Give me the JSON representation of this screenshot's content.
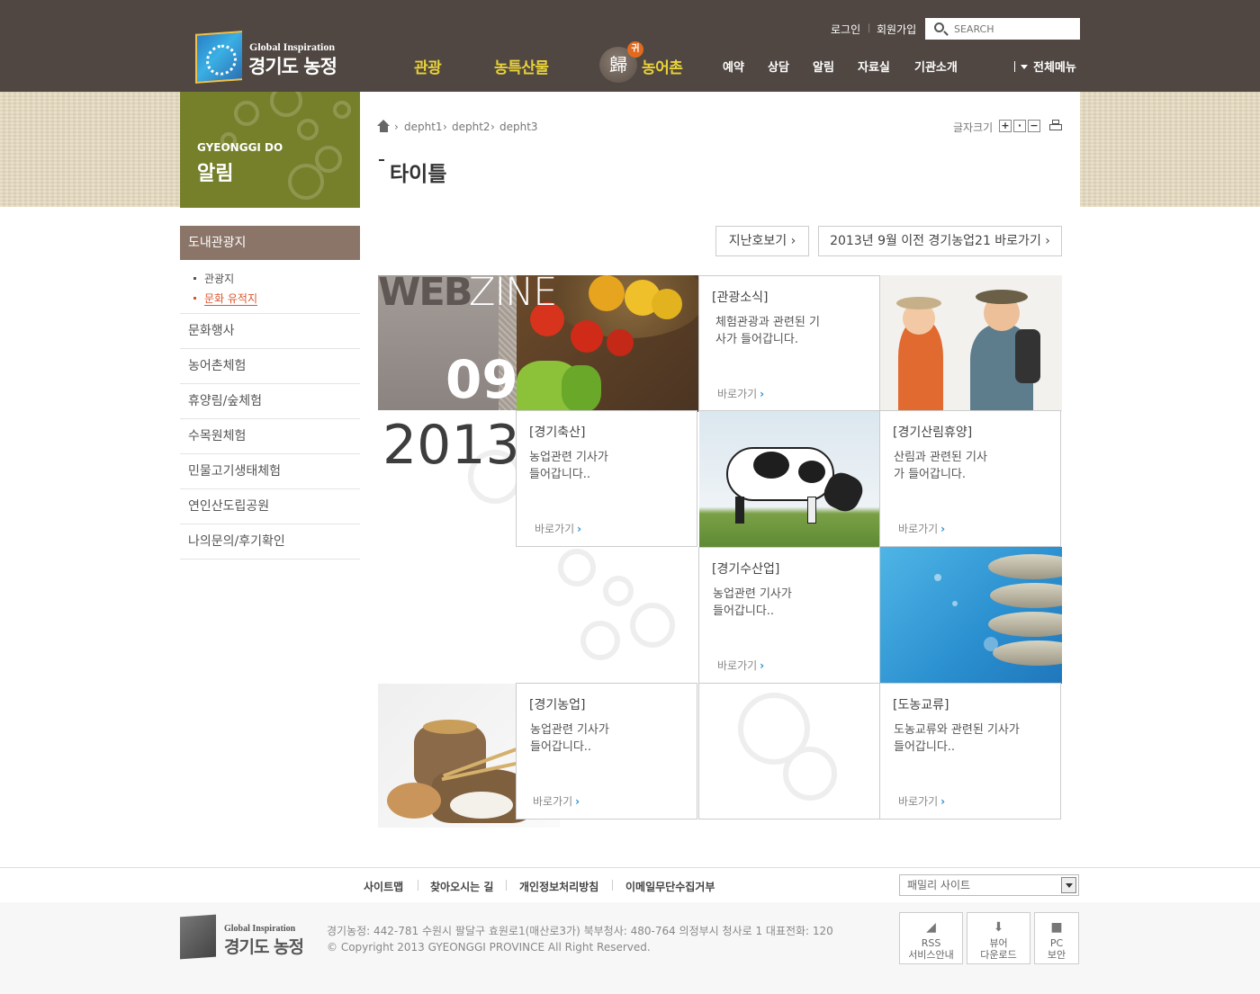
{
  "header": {
    "logo_sub": "Global Inspiration",
    "logo_main": "경기도 농정",
    "util": {
      "login": "로그인",
      "join": "회원가입"
    },
    "search": {
      "placeholder": "SEARCH"
    },
    "gnb_main": [
      "관광",
      "농특산물",
      "농어촌"
    ],
    "gnb_badge": "歸",
    "gnb_badge_dot": "귀",
    "gnb_sub": [
      "예약",
      "상담",
      "알림",
      "자료실",
      "기관소개"
    ],
    "all_menu": "전체메뉴"
  },
  "lnb": {
    "title_eng": "GYEONGGI DO",
    "title_kor": "알림",
    "active": "도내관광지",
    "sub_items": [
      "관광지",
      "문화 유적지"
    ],
    "items": [
      "문화행사",
      "농어촌체험",
      "휴양림/숲체험",
      "수목원체험",
      "민물고기생태체험",
      "연인산도립공원",
      "나의문의/후기확인"
    ]
  },
  "breadcrumb": [
    "depht1",
    "depht2",
    "depht3"
  ],
  "font_size_label": "글자크기",
  "page_title": "타이틀",
  "buttons": {
    "past": "지난호보기",
    "before2013": "2013년 9월 이전 경기농업21 바로가기"
  },
  "webzine": {
    "word_a": "WEB",
    "word_b": "ZINE",
    "month": "09",
    "year": "2013",
    "go_label": "바로가기",
    "tiles": [
      {
        "title": "[관광소식]",
        "desc": "체험관광과 관련된 기사가 들어갑니다."
      },
      {
        "title": "[경기축산]",
        "desc": "농업관련 기사가 들어갑니다.."
      },
      {
        "title": "[경기산림휴양]",
        "desc": "산림과 관련된 기사가 들어갑니다."
      },
      {
        "title": "[경기수산업]",
        "desc": "농업관련 기사가 들어갑니다.."
      },
      {
        "title": "[경기농업]",
        "desc": "농업관련 기사가 들어갑니다.."
      },
      {
        "title": "[도농교류]",
        "desc": "도농교류와 관련된 기사가 들어갑니다.."
      }
    ]
  },
  "footer": {
    "links": [
      "사이트맵",
      "찾아오시는 길",
      "개인정보처리방침",
      "이메일무단수집거부"
    ],
    "family_site": "패밀리 사이트",
    "logo_sub": "Global Inspiration",
    "logo_main": "경기도 농정",
    "address": "경기농정: 442-781 수원시 팔달구 효원로1(매산로3가)   북부청사: 480-764 의정부시 청사로 1   대표전화: 120",
    "copyright": "© Copyright 2013 GYEONGGI PROVINCE All Right Reserved.",
    "quick": [
      {
        "line1": "RSS",
        "line2": "서비스안내"
      },
      {
        "line1": "뷰어",
        "line2": "다운로드"
      },
      {
        "line1": "PC",
        "line2": "보안"
      }
    ]
  },
  "colors": {
    "header_bg": "#504742",
    "gnb_accent": "#e8d23a",
    "lnb_title_bg": "#76802a",
    "lnb_active_bg": "#8b7569",
    "link_active": "#d9572c"
  }
}
